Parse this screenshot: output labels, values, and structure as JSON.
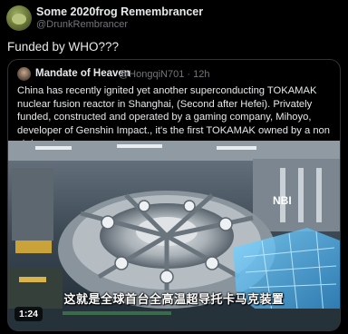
{
  "post": {
    "author_name": "Some 2020frog Remembrancer",
    "author_handle": "@DrunkRembrancer",
    "text": "Funded by WHO???"
  },
  "quote": {
    "author_name": "Mandate of Heaven",
    "author_handle": "@HongqiN701",
    "separator": "·",
    "time_ago": "12h",
    "text": "China has recently ignited yet another superconducting TOKAMAK nuclear fusion reactor in Shanghai, (Second after  Hefei). Privately funded, constructed and operated by a gaming company, Mihoyo, developer of Genshin Impact., it's the first TOKAMAK owned by a non state actor."
  },
  "video": {
    "subtitle": "这就是全球首台全高温超导托卡马克装置",
    "overlay_label": "NBI",
    "duration": "1:24"
  }
}
